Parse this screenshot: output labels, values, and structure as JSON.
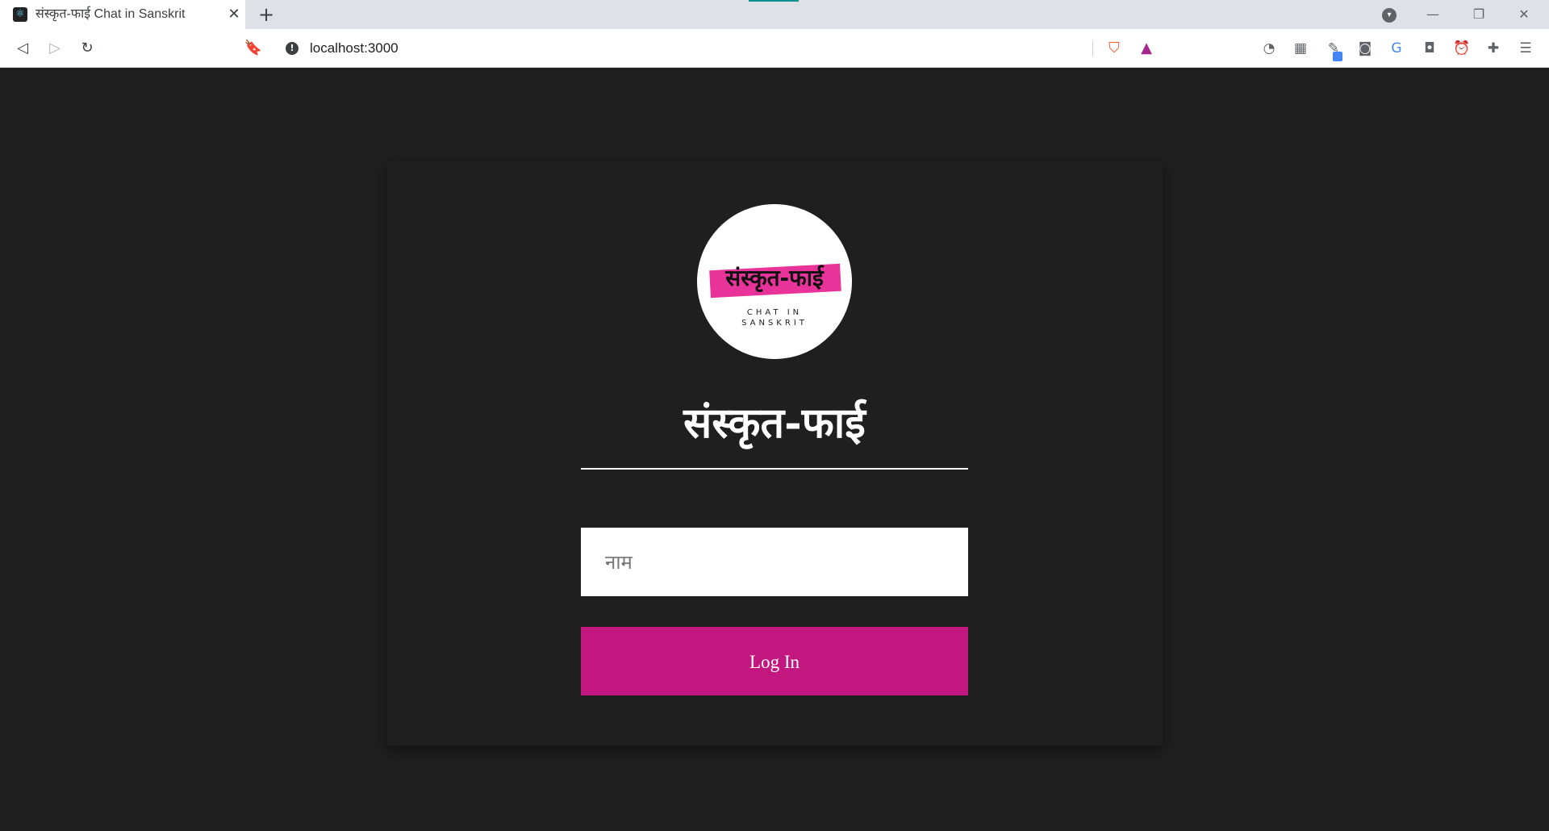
{
  "browser": {
    "tab": {
      "title": "संस्कृत-फाई Chat in Sanskrit",
      "favicon": "react-icon"
    },
    "url": "localhost:3000",
    "window_controls": [
      "minimize",
      "restore",
      "close"
    ],
    "extensions": [
      "timer-icon",
      "extension-grid-icon",
      "pen-icon",
      "camera-icon",
      "translate-icon",
      "profile-icon",
      "alarm-icon",
      "puzzle-icon",
      "menu-icon"
    ]
  },
  "app": {
    "logo": {
      "word": "संस्कृत-फाई",
      "tagline_line1": "CHAT IN",
      "tagline_line2": "SANSKRIT",
      "highlight_color": "#e8349a"
    },
    "title": "संस्कृत-फाई",
    "name_input": {
      "placeholder": "नाम",
      "value": ""
    },
    "login_button": "Log In",
    "colors": {
      "background": "#201f20",
      "accent": "#c2177f"
    }
  }
}
